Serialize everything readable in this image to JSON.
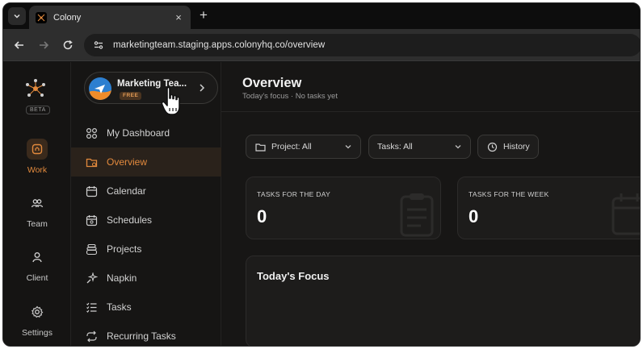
{
  "browser": {
    "tab_title": "Colony",
    "tab_close": "×",
    "new_tab": "+",
    "url": "marketingteam.staging.apps.colonyhq.co/overview"
  },
  "rail": {
    "beta_badge": "BETA",
    "items": [
      {
        "label": "Work",
        "icon": "home-icon",
        "active": true
      },
      {
        "label": "Team",
        "icon": "team-icon",
        "active": false
      },
      {
        "label": "Client",
        "icon": "user-icon",
        "active": false
      },
      {
        "label": "Settings",
        "icon": "gear-icon",
        "active": false
      }
    ]
  },
  "workspace": {
    "name": "Marketing Tea...",
    "plan": "FREE"
  },
  "sidebar": {
    "items": [
      {
        "label": "My Dashboard",
        "icon": "dashboard-icon",
        "active": false
      },
      {
        "label": "Overview",
        "icon": "folder-icon",
        "active": true
      },
      {
        "label": "Calendar",
        "icon": "calendar-icon",
        "active": false
      },
      {
        "label": "Schedules",
        "icon": "schedule-icon",
        "active": false
      },
      {
        "label": "Projects",
        "icon": "projects-icon",
        "active": false
      },
      {
        "label": "Napkin",
        "icon": "sparkle-icon",
        "active": false
      },
      {
        "label": "Tasks",
        "icon": "tasks-icon",
        "active": false
      },
      {
        "label": "Recurring Tasks",
        "icon": "recurring-icon",
        "active": false
      }
    ]
  },
  "main": {
    "title": "Overview",
    "subtitle": "Today's focus · No tasks yet",
    "filters": {
      "project": "Project: All",
      "tasks": "Tasks: All",
      "history": "History"
    },
    "stats": [
      {
        "label": "TASKS FOR THE DAY",
        "value": "0"
      },
      {
        "label": "TASKS FOR THE WEEK",
        "value": "0"
      }
    ],
    "focus_title": "Today's Focus"
  },
  "colors": {
    "accent": "#e38a3d",
    "background": "#161514",
    "card": "#1d1c1b"
  }
}
